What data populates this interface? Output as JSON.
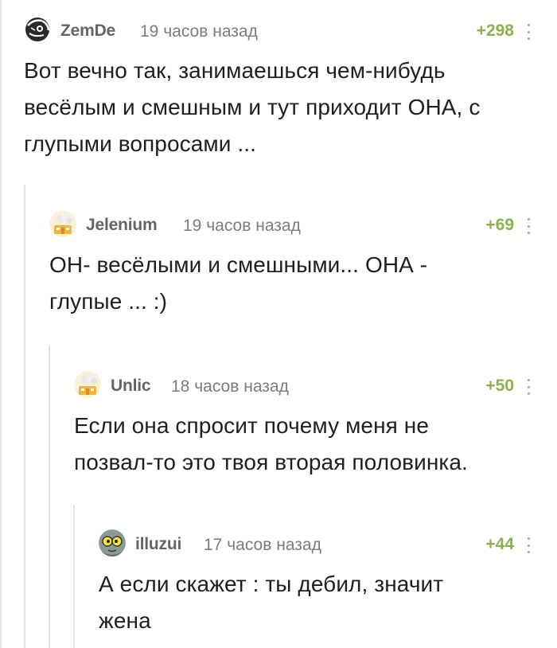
{
  "comments": [
    {
      "username": "ZemDe",
      "time": "19 часов назад",
      "rating": "+298",
      "avatar": "dark-sketch-avatar",
      "lines": [
        "Вот вечно так, занимаешься чем-нибудь",
        "весёлым и смешным и тут приходит ОНА, с",
        "глупыми вопросами ..."
      ]
    },
    {
      "username": "Jelenium",
      "time": "19 часов назад",
      "rating": "+69",
      "avatar": "default-avatar",
      "lines": [
        "ОН- весёлыми и смешными... ОНА -",
        "глупые ...  :)"
      ]
    },
    {
      "username": "Unlic",
      "time": "18 часов назад",
      "rating": "+50",
      "avatar": "default-avatar",
      "lines": [
        "Если она спросит почему меня не",
        "позвал-то это твоя вторая половинка."
      ]
    },
    {
      "username": "illuzui",
      "time": "17 часов назад",
      "rating": "+44",
      "avatar": "cartoon-face-avatar",
      "lines": [
        "А если скажет : ты дебил, значит",
        "жена"
      ]
    }
  ],
  "colors": {
    "rating": "#8ab14e",
    "username": "#656565",
    "time": "#7c7c7c",
    "text": "#1f1f1f"
  }
}
